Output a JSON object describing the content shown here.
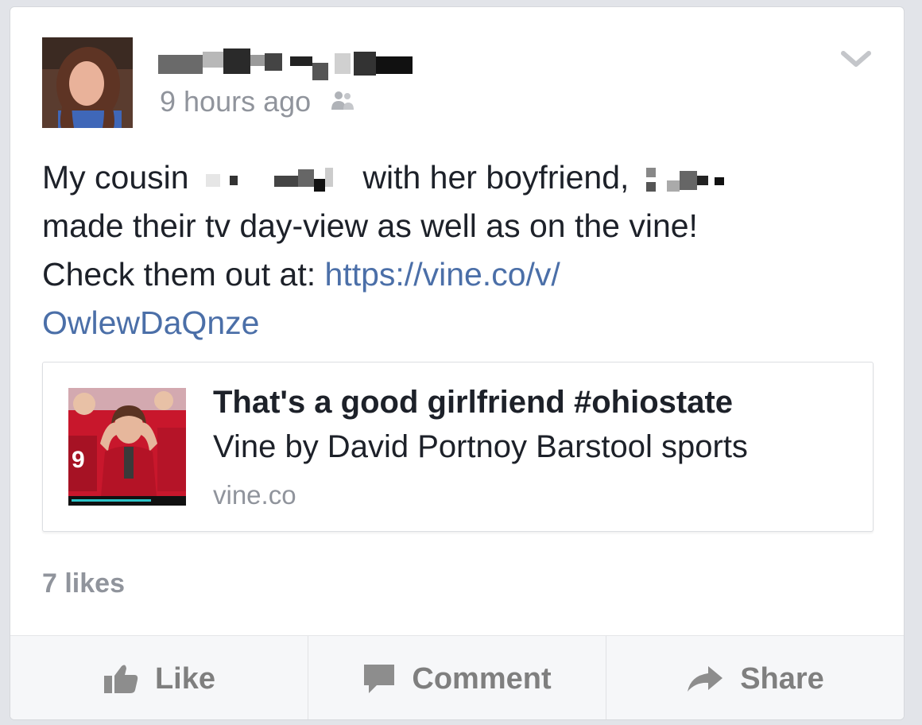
{
  "post": {
    "timestamp": "9 hours ago",
    "audience_icon": "friends-icon",
    "text_part1": "My cousin",
    "text_part2": "with her boyfriend,",
    "text_part3": "made their tv day-view as well as on the vine!",
    "text_part4": "Check them out at:",
    "link_line1": "https://vine.co/v/",
    "link_line2": "OwlewDaQnze"
  },
  "preview": {
    "title": "That's a good girlfriend #ohiostate",
    "subtitle": "Vine by David Portnoy Barstool sports",
    "domain": "vine.co"
  },
  "stats": {
    "likes": "7 likes"
  },
  "actions": {
    "like": "Like",
    "comment": "Comment",
    "share": "Share"
  },
  "colors": {
    "link": "#4b6fa8",
    "muted": "#90949c",
    "text": "#1d2129"
  }
}
